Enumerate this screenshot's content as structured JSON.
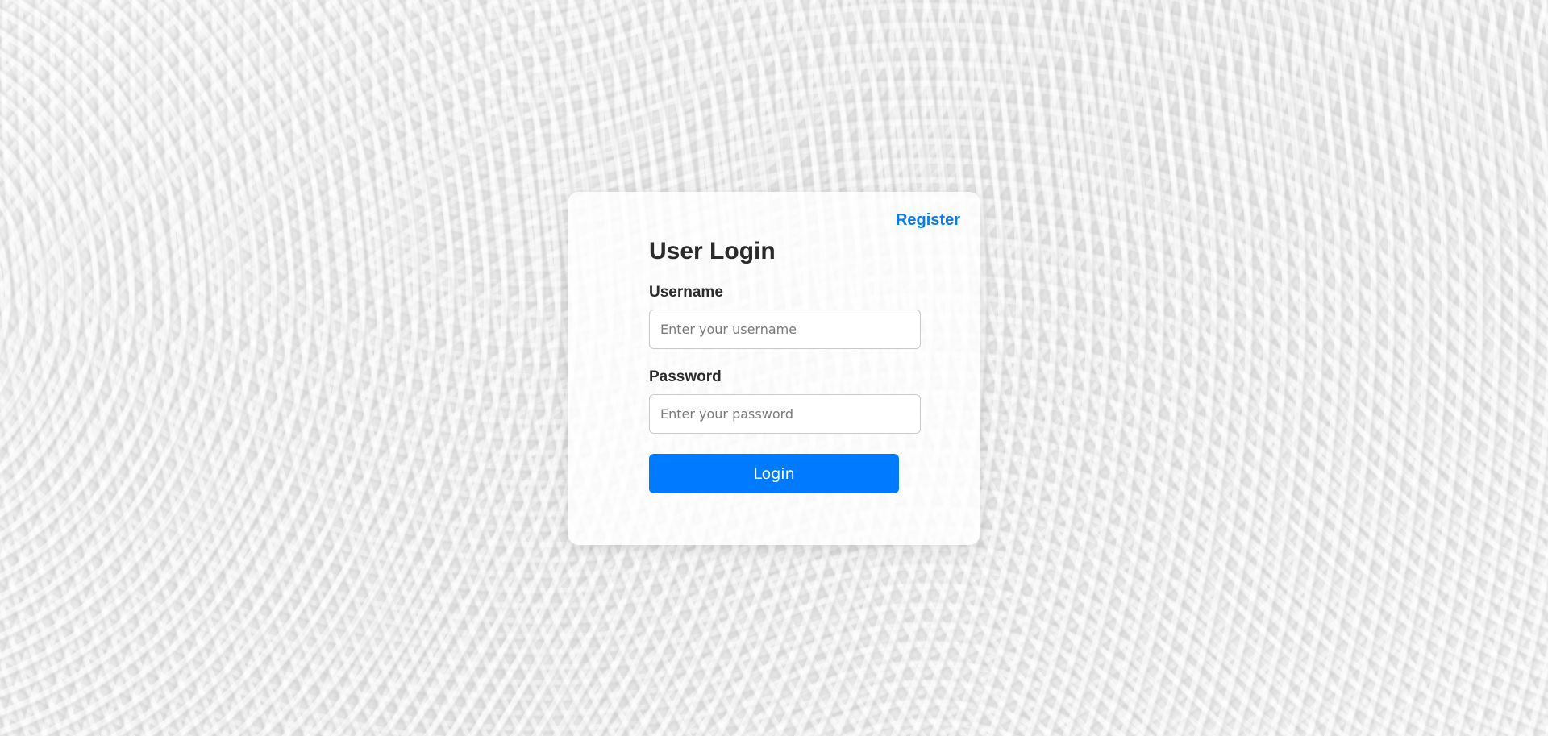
{
  "header": {
    "register_link": "Register"
  },
  "login_form": {
    "title": "User Login",
    "username": {
      "label": "Username",
      "value": "",
      "placeholder": "Enter your username"
    },
    "password": {
      "label": "Password",
      "value": "",
      "placeholder": "Enter your password"
    },
    "submit_label": "Login"
  },
  "colors": {
    "accent": "#007bff",
    "link": "#0a7bea",
    "text": "#2b2b2b"
  }
}
